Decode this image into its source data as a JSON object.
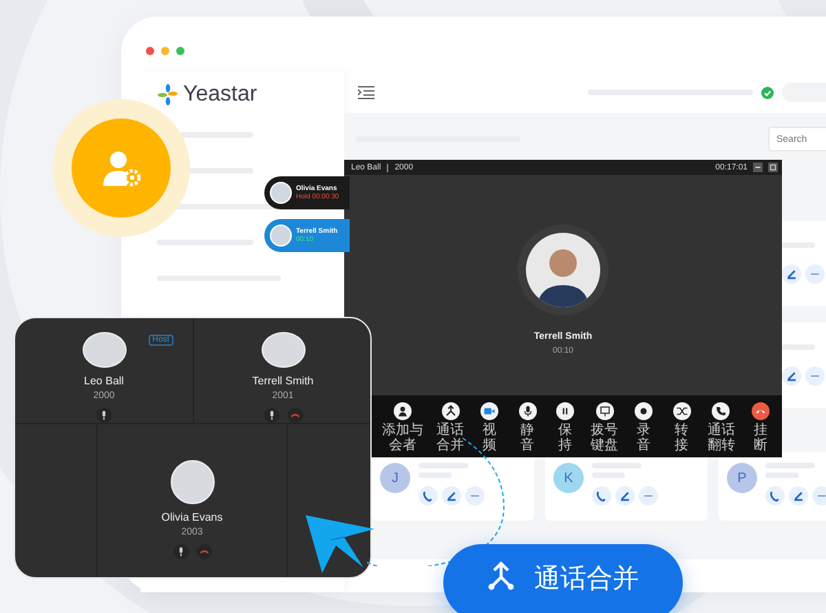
{
  "sidebar": {
    "logo_text": "Yeastar"
  },
  "search": {
    "placeholder": "Search"
  },
  "contacts": [
    {
      "initial": "J",
      "color": "#b7c6e8"
    },
    {
      "initial": "K",
      "color": "#9dd7f0"
    },
    {
      "initial": "P",
      "color": "#b7c6e8"
    }
  ],
  "call_list": [
    {
      "name": "Olivia Evans",
      "status": "Hold 00:00:30",
      "on_hold": true,
      "selected": false
    },
    {
      "name": "Terrell Smith",
      "status": "00:10",
      "on_hold": false,
      "selected": true
    }
  ],
  "call_window": {
    "caller": "Leo Ball",
    "extension": "2000",
    "timer": "00:17:01",
    "contact_name": "Terrell Smith",
    "duration": "00:10",
    "actions": [
      {
        "label": "添加与会者",
        "kind": "action"
      },
      {
        "label": "通话合并",
        "kind": "action"
      },
      {
        "label": "视频",
        "kind": "action"
      },
      {
        "label": "静音",
        "kind": "action"
      },
      {
        "label": "保持",
        "kind": "action"
      },
      {
        "label": "拨号键盘",
        "kind": "action"
      },
      {
        "label": "录音",
        "kind": "action"
      },
      {
        "label": "转接",
        "kind": "action"
      },
      {
        "label": "通话翻转",
        "kind": "action"
      },
      {
        "label": "挂断",
        "kind": "hangup"
      }
    ]
  },
  "conference": {
    "participants": [
      {
        "name": "Leo Ball",
        "extension": "2000",
        "badge": "Host",
        "can_hang_up": false
      },
      {
        "name": "Terrell Smith",
        "extension": "2001",
        "can_hang_up": true
      },
      {
        "name": "Olivia Evans",
        "extension": "2003",
        "can_hang_up": true
      }
    ]
  },
  "merge_button": {
    "label": "通话合并"
  }
}
